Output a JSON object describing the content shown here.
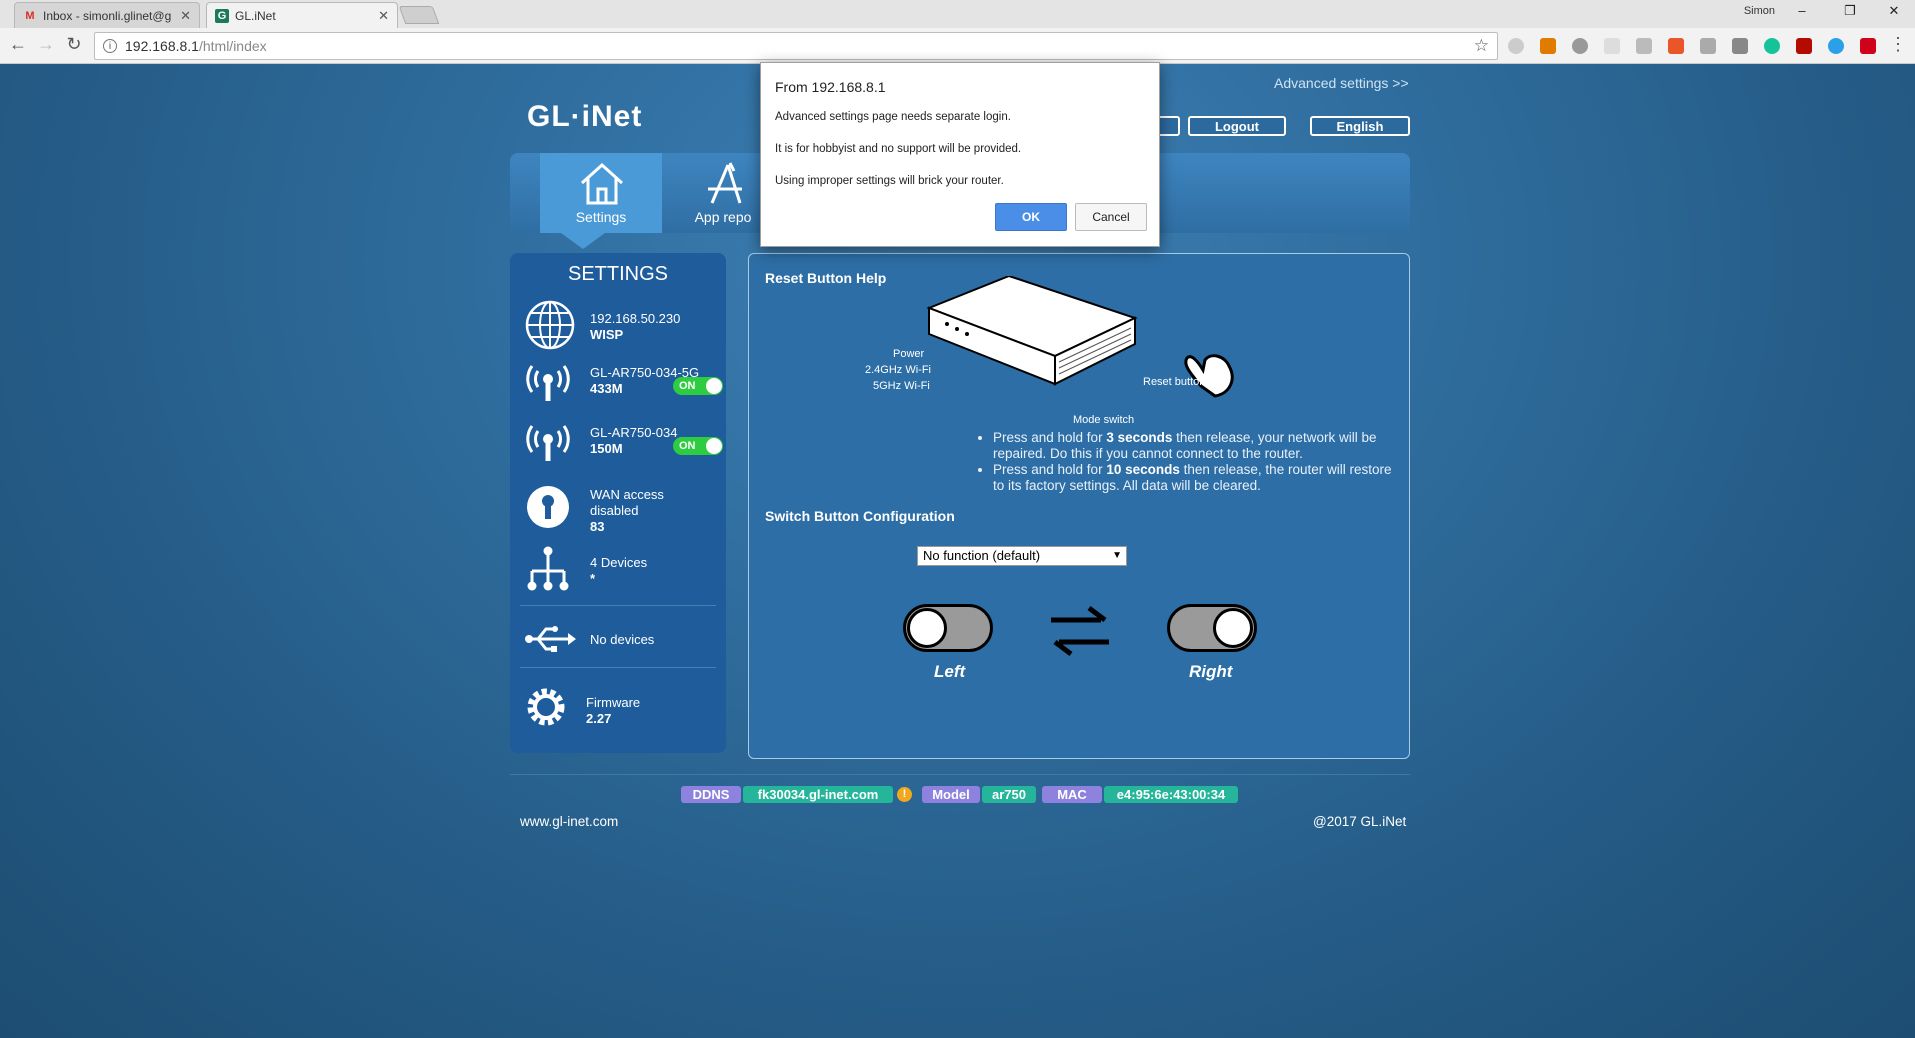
{
  "browser": {
    "tabs": [
      {
        "label": "Inbox - simonli.glinet@g",
        "favicon": "gmail-icon",
        "color": "#d93025"
      },
      {
        "label": "GL.iNet",
        "favicon": "glinet-favicon",
        "color": "#1b7a5a"
      }
    ],
    "tab_close": "✕",
    "user": "Simon",
    "url_host": "192.168.8.1",
    "url_path": "/html/index"
  },
  "header": {
    "advanced_link": "Advanced settings >>",
    "logo": "GL·iNet",
    "logout": "Logout",
    "language": "English"
  },
  "nav": {
    "items": [
      {
        "label": "Settings",
        "icon": "home-icon"
      },
      {
        "label": "App repo",
        "icon": "app-store-icon"
      }
    ]
  },
  "sidebar": {
    "title": "SETTINGS",
    "items": [
      {
        "icon": "globe-icon",
        "line1": "192.168.50.230",
        "line2": "WISP"
      },
      {
        "icon": "wifi-icon",
        "line1": "GL-AR750-034-5G",
        "line2": "433M",
        "toggle": "ON"
      },
      {
        "icon": "wifi-icon",
        "line1": "GL-AR750-034",
        "line2": "150M",
        "toggle": "ON"
      },
      {
        "icon": "keyhole-icon",
        "line1": "WAN access",
        "line1b": "disabled",
        "line2": "83"
      },
      {
        "icon": "network-icon",
        "line1": "4 Devices",
        "line2": "*"
      },
      {
        "icon": "usb-icon",
        "line1": "No devices"
      },
      {
        "icon": "gear-icon",
        "line1": "Firmware",
        "line2": "2.27"
      }
    ]
  },
  "main": {
    "reset_title": "Reset Button Help",
    "labels": {
      "power": "Power",
      "wifi24": "2.4GHz Wi-Fi",
      "wifi5": "5GHz Wi-Fi",
      "reset": "Reset button",
      "mode": "Mode switch"
    },
    "help1_pre": "Press and hold for ",
    "help1_bold": "3 seconds",
    "help1_post": " then release, your network will be repaired. Do this if you cannot connect to the router.",
    "help2_pre": "Press and hold for ",
    "help2_bold": "10 seconds",
    "help2_post": " then release, the router will restore to its factory settings. All data will be cleared.",
    "switch_title": "Switch Button Configuration",
    "switch_select": "No function (default)",
    "left_label": "Left",
    "right_label": "Right"
  },
  "footer": {
    "ddns_label": "DDNS",
    "ddns_value": "fk30034.gl-inet.com",
    "warn": "!",
    "model_label": "Model",
    "model_value": "ar750",
    "mac_label": "MAC",
    "mac_value": "e4:95:6e:43:00:34",
    "site": "www.gl-inet.com",
    "copyright": "@2017 GL.iNet"
  },
  "dialog": {
    "title": "From 192.168.8.1",
    "line1": "Advanced settings page needs separate login.",
    "line2": "It is for hobbyist and no support will be provided.",
    "line3": "Using improper settings will brick your router.",
    "ok": "OK",
    "cancel": "Cancel"
  }
}
